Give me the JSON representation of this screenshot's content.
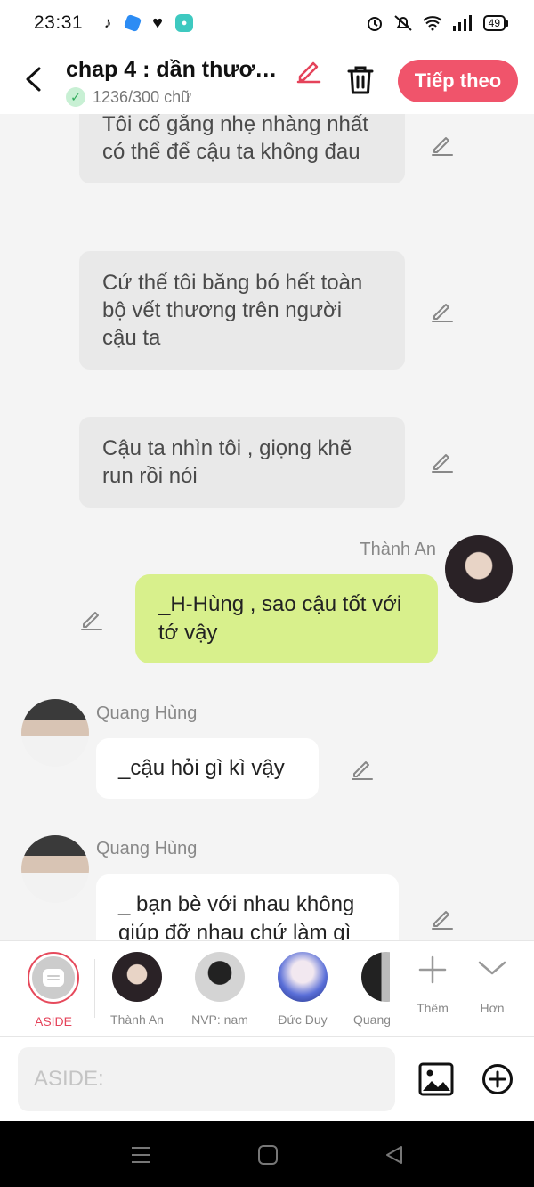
{
  "status": {
    "time": "23:31",
    "battery": "49"
  },
  "header": {
    "title": "chap 4 : dần thương...",
    "word_count": "1236/300 chữ",
    "next_label": "Tiếp theo"
  },
  "messages": {
    "narr1": "Tôi cố gắng nhẹ nhàng nhất có thể để cậu ta không đau",
    "narr2": "Cứ thế tôi băng bó hết toàn bộ vết thương trên người cậu ta",
    "narr3": "Cậu ta nhìn tôi , giọng khẽ run rồi nói",
    "msg1_name": "Thành An",
    "msg1_text": "_H-Hùng , sao cậu tốt với tớ vậy",
    "msg2_name": "Quang Hùng",
    "msg2_text": "_cậu hỏi gì kì vậy",
    "msg3_name": "Quang Hùng",
    "msg3_text": "_ bạn bè với nhau không giúp đỡ nhau chứ làm gì"
  },
  "characters": {
    "aside": "ASIDE",
    "c1": "Thành An",
    "c2": "NVP: nam",
    "c3": "Đức Duy",
    "c4": "Quang Hùng",
    "more": "Thêm",
    "less": "Hơn"
  },
  "input": {
    "placeholder": "ASIDE:"
  },
  "colors": {
    "accent": "#f0546b",
    "green_bubble": "#d8f08c"
  }
}
